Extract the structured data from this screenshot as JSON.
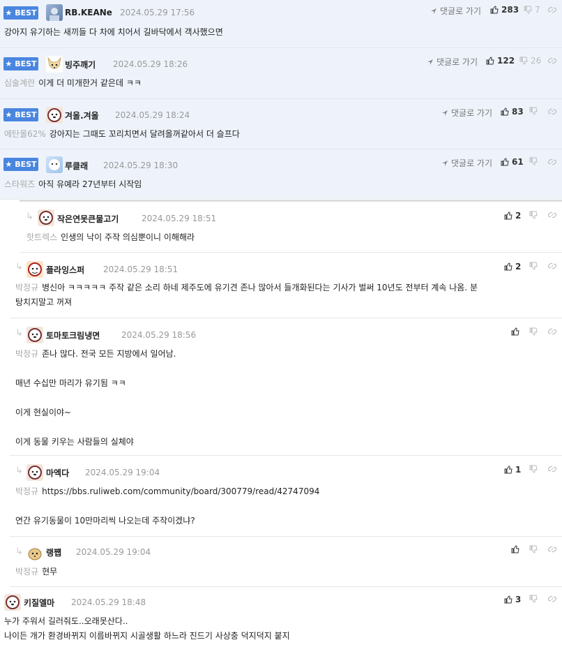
{
  "labels": {
    "best": "BEST",
    "goto_reply": "댓글로 가기"
  },
  "comments": [
    {
      "nick": "RB.KEANe",
      "time": "2024.05.29 17:56",
      "up": "283",
      "down": "7",
      "tag": "",
      "text": "강아지 유기하는 새끼들 다 차에 치어서 길바닥에서 객사했으면"
    },
    {
      "nick": "빙주깨기",
      "time": "2024.05.29 18:26",
      "up": "122",
      "down": "26",
      "tag": "심술계란",
      "text": "이게 더 미개한거 같은데 ㅋㅋ"
    },
    {
      "nick": "겨울.겨울",
      "time": "2024.05.29 18:24",
      "up": "83",
      "down": "",
      "tag": "에탄올62%",
      "text": "강아지는 그때도 꼬리치면서 달려올꺼같아서 더 슬프다"
    },
    {
      "nick": "루클래",
      "time": "2024.05.29 18:30",
      "up": "61",
      "down": "",
      "tag": "스타워즈",
      "text": "아직 유예라 27년부터 시작임"
    },
    {
      "nick": "작은연못큰물고기",
      "time": "2024.05.29 18:51",
      "up": "2",
      "down": "",
      "tag": "핫트렉스",
      "text": "인생의 낙이 주작 의심뿐이니 이해해라"
    },
    {
      "nick": "플라잉스퍼",
      "time": "2024.05.29 18:51",
      "up": "2",
      "down": "",
      "tag": "박정규",
      "text": "병신아 ㅋㅋㅋㅋㅋ 주작 같은 소리 하네 제주도에 유기견 존나 많아서 들개화된다는 기사가 벌써 10년도 전부터 계속 나옴. 분\n탕치지말고 꺼져"
    },
    {
      "nick": "토마토크림냉면",
      "time": "2024.05.29 18:56",
      "up": "",
      "down": "",
      "tag": "박정규",
      "text": "존나 많다. 전국 모든 지방에서 일어남.\n\n매년 수십만 마리가 유기됨 ㅋㅋ\n\n이게 현실이야~\n\n이게 동물 키우는 사람들의 실체야"
    },
    {
      "nick": "마엑다",
      "time": "2024.05.29 19:04",
      "up": "1",
      "down": "",
      "tag": "박정규",
      "text": "https://bbs.ruliweb.com/community/board/300779/read/42747094\n\n연간 유기동물이 10만마리씩 나오는데 주작이겠냐?"
    },
    {
      "nick": "랭쩁",
      "time": "2024.05.29 19:04",
      "up": "",
      "down": "",
      "tag": "박정규",
      "text": "현무"
    },
    {
      "nick": "키질엘마",
      "time": "2024.05.29 18:48",
      "up": "3",
      "down": "",
      "tag": "",
      "text": "누가 주워서 길러줘도..오래못산다..\n나이든 개가 환경바뀌지 이름바뀌지 시골생활 하느라 진드기 사상충 덕지덕지 붙지"
    }
  ],
  "colors": {
    "best_badge": "#4a86e0",
    "best_bg": "#eef3fb",
    "tag_gray": "#a8a8a8"
  }
}
